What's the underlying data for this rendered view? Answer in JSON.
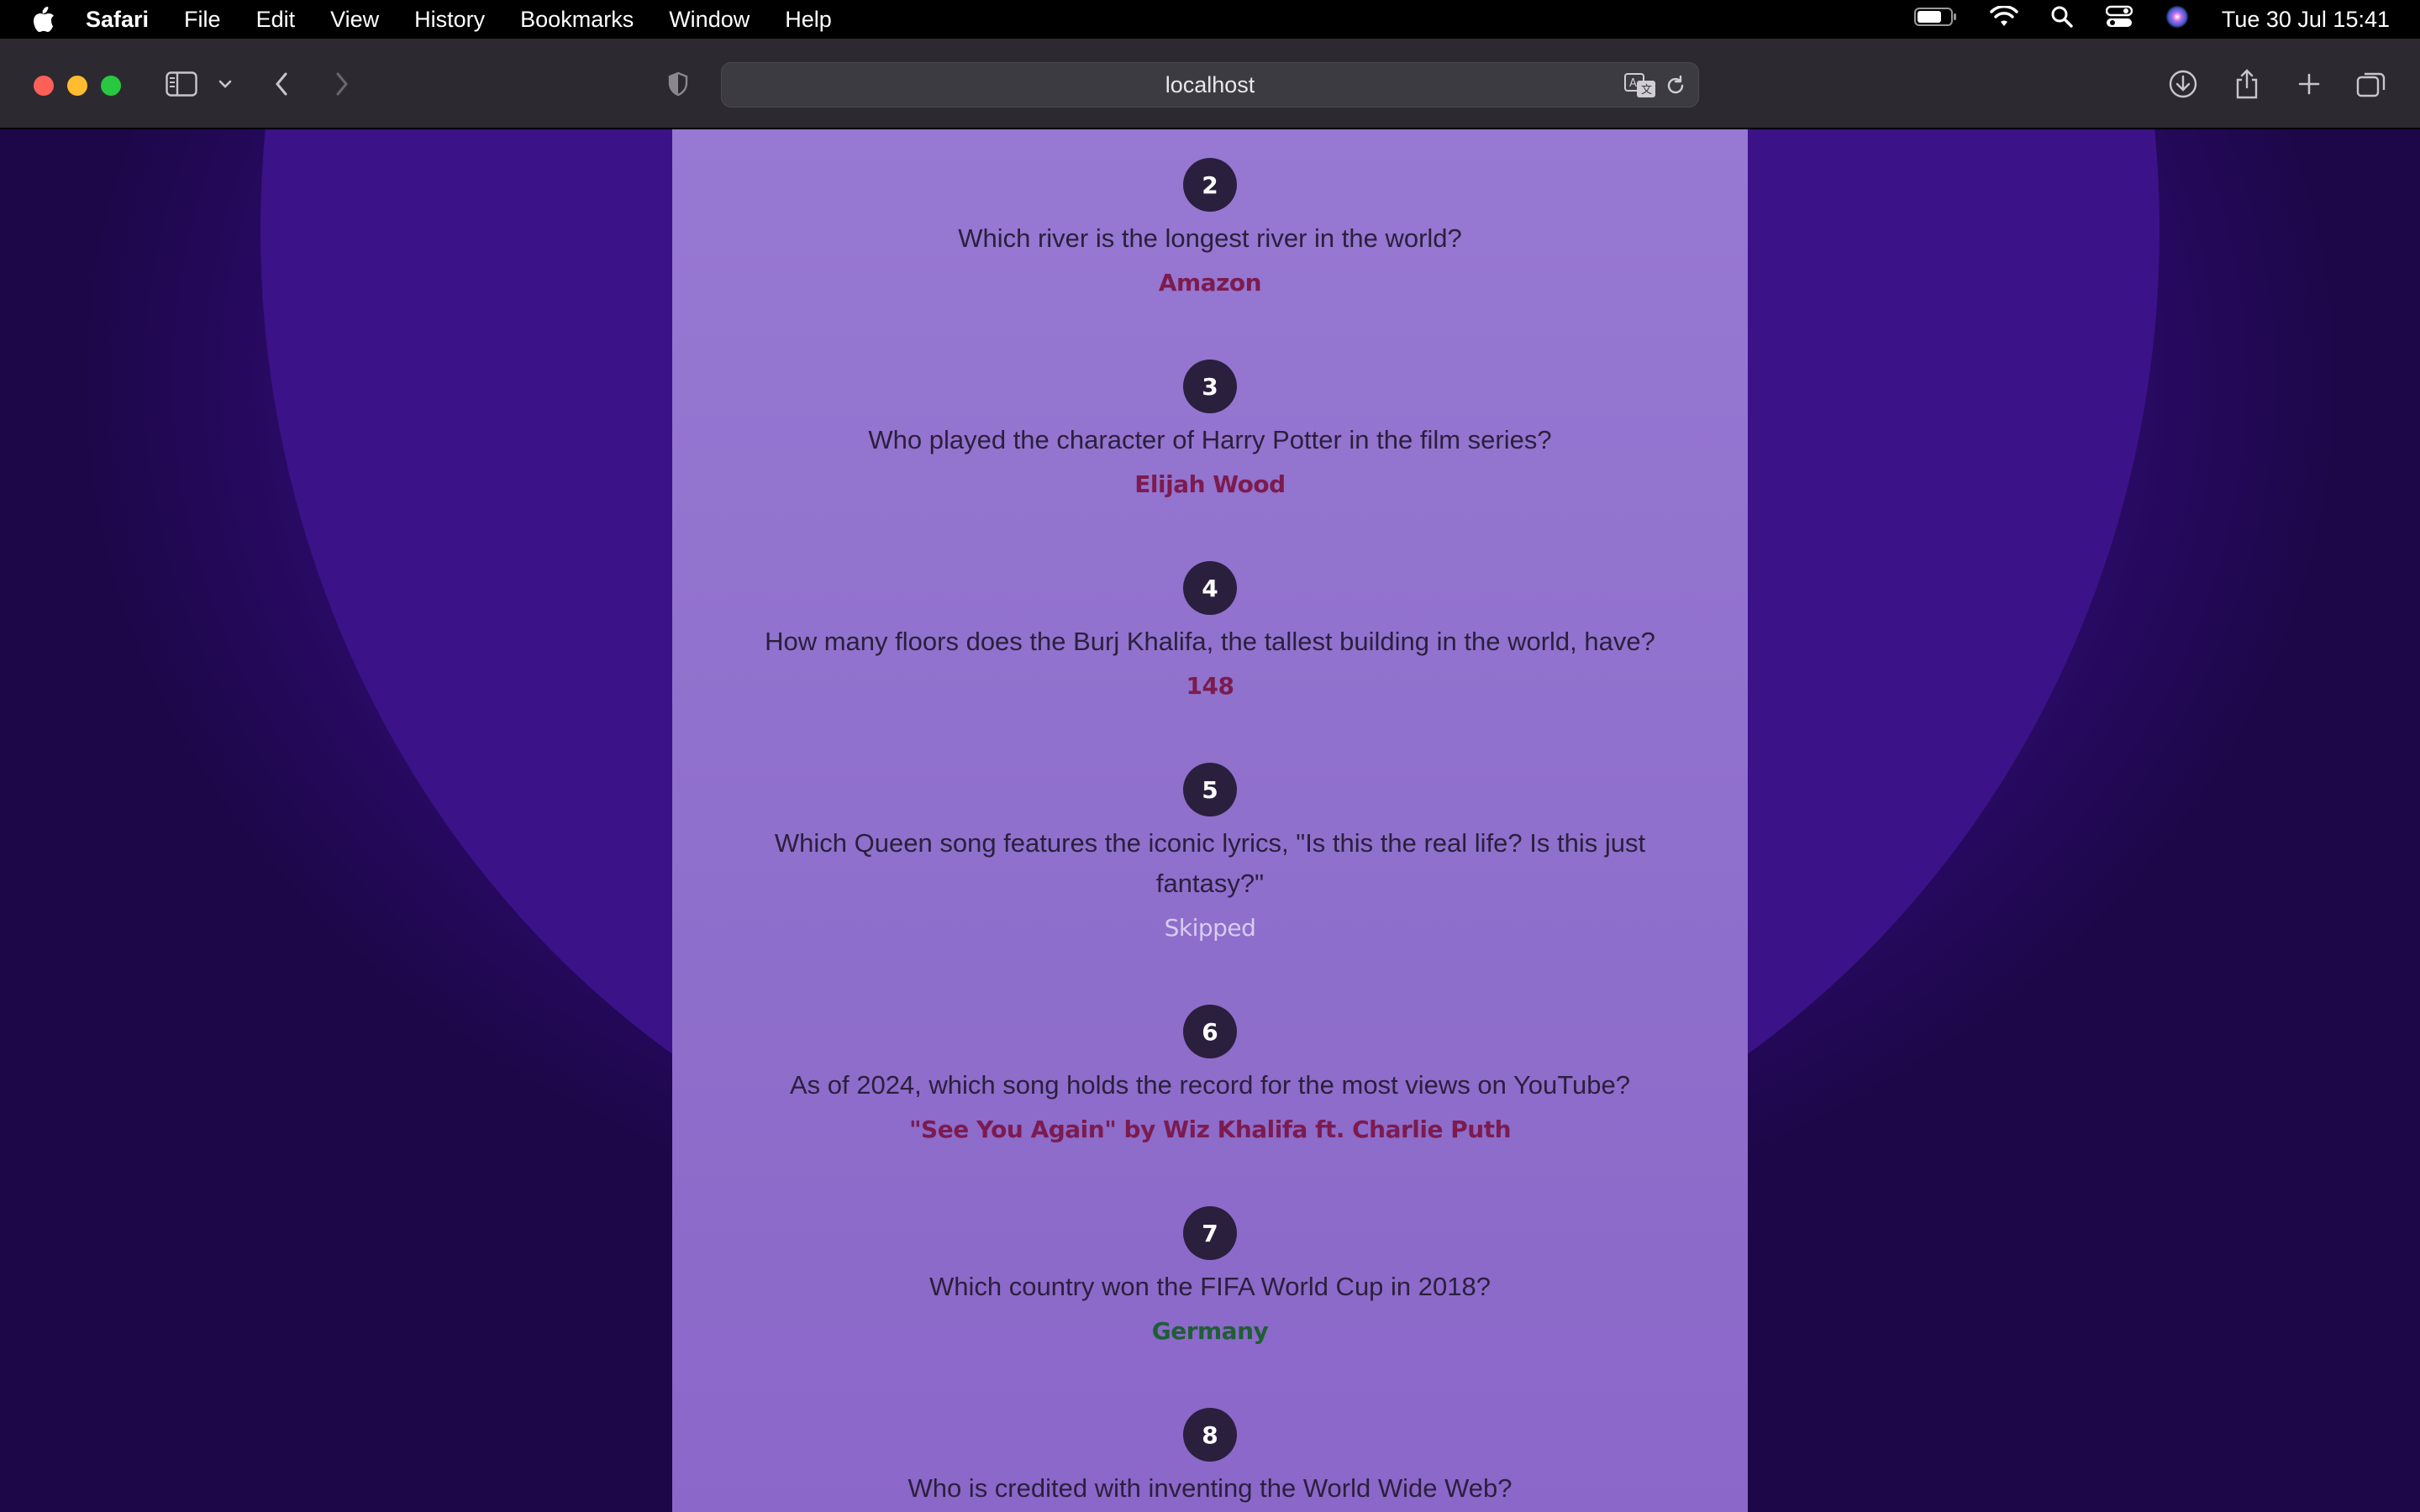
{
  "menubar": {
    "app_name": "Safari",
    "items": [
      "File",
      "Edit",
      "View",
      "History",
      "Bookmarks",
      "Window",
      "Help"
    ],
    "clock": "Tue 30 Jul  15:41"
  },
  "browser": {
    "url": "localhost"
  },
  "questions": [
    {
      "number": "2",
      "text": "Which river is the longest river in the world?",
      "answer": "Amazon",
      "status": "wrong"
    },
    {
      "number": "3",
      "text": "Who played the character of Harry Potter in the film series?",
      "answer": "Elijah Wood",
      "status": "wrong"
    },
    {
      "number": "4",
      "text": "How many floors does the Burj Khalifa, the tallest building in the world, have?",
      "answer": "148",
      "status": "wrong"
    },
    {
      "number": "5",
      "text": "Which Queen song features the iconic lyrics, \"Is this the real life? Is this just fantasy?\"",
      "answer": "Skipped",
      "status": "skipped"
    },
    {
      "number": "6",
      "text": "As of 2024, which song holds the record for the most views on YouTube?",
      "answer": "\"See You Again\" by Wiz Khalifa ft. Charlie Puth",
      "status": "wrong"
    },
    {
      "number": "7",
      "text": "Which country won the FIFA World Cup in 2018?",
      "answer": "Germany",
      "status": "correct"
    },
    {
      "number": "8",
      "text": "Who is credited with inventing the World Wide Web?",
      "answer": "",
      "status": ""
    }
  ],
  "colors": {
    "wrong": "#7c1b4f",
    "correct": "#1f5e35",
    "skipped": "#d8ccf0",
    "panel": "#9070cc",
    "badge": "#2a1f3d"
  }
}
